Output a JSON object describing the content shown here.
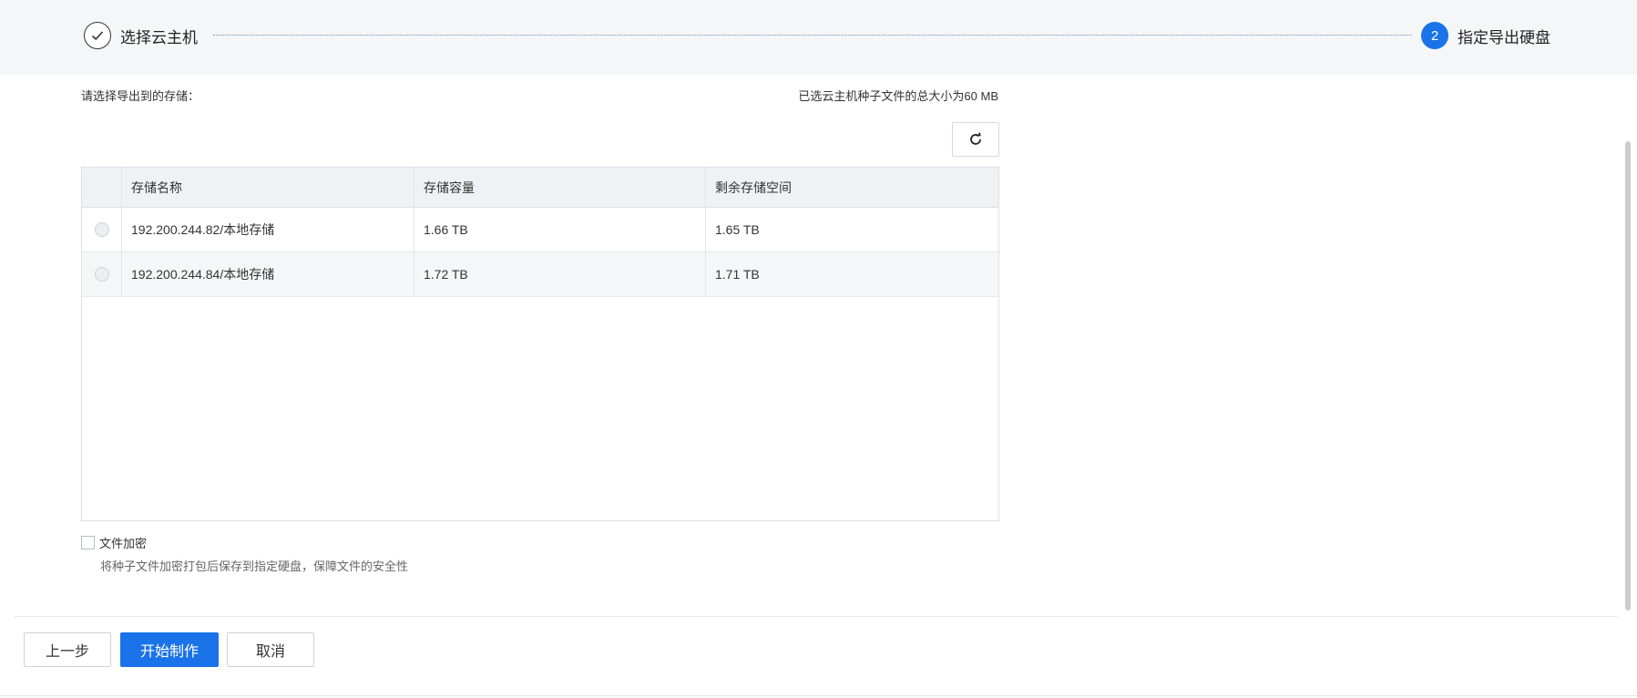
{
  "steps": [
    {
      "label": "选择云主机",
      "state": "done",
      "icon": "check-icon"
    },
    {
      "label": "指定导出硬盘",
      "state": "active",
      "number": "2"
    }
  ],
  "storage": {
    "prompt": "请选择导出到的存储：",
    "total_size_text": "已选云主机种子文件的总大小为60 MB",
    "refresh_icon": "refresh-icon",
    "columns": [
      "存储名称",
      "存储容量",
      "剩余存储空间"
    ],
    "rows": [
      {
        "name": "192.200.244.82/本地存储",
        "capacity": "1.66 TB",
        "free": "1.65 TB",
        "selected": false
      },
      {
        "name": "192.200.244.84/本地存储",
        "capacity": "1.72 TB",
        "free": "1.71 TB",
        "selected": false
      }
    ]
  },
  "encrypt": {
    "label": "文件加密",
    "checked": false,
    "hint": "将种子文件加密打包后保存到指定硬盘，保障文件的安全性"
  },
  "footer": {
    "prev_label": "上一步",
    "start_label": "开始制作",
    "cancel_label": "取消"
  },
  "colors": {
    "accent": "#1a73e8",
    "header_bg": "#f5f6f8",
    "table_header_bg": "#eff1f4"
  }
}
